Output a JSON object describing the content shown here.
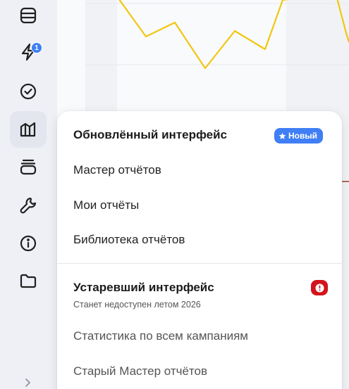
{
  "sidebar": {
    "icons": [
      {
        "name": "database-icon"
      },
      {
        "name": "lightning-icon",
        "badge": "1"
      },
      {
        "name": "check-circle-icon"
      },
      {
        "name": "reports-icon",
        "active": true
      },
      {
        "name": "stack-icon"
      },
      {
        "name": "wrench-icon"
      },
      {
        "name": "info-icon"
      },
      {
        "name": "folder-icon"
      }
    ],
    "expand_icon": "chevron-right-icon"
  },
  "menu": {
    "new_section": {
      "title": "Обновлённый интерфейс",
      "badge_label": "Новый",
      "badge_icon": "star-icon",
      "badge_color": "#3f7ef5",
      "items": [
        "Мастер отчётов",
        "Мои отчёты",
        "Библиотека отчётов"
      ]
    },
    "legacy_section": {
      "title": "Устаревший интерфейс",
      "subtitle": "Станет недоступен летом 2026",
      "warning_icon": "exclamation-icon",
      "warning_color": "#d3141c",
      "items": [
        "Статистика по всем кампаниям",
        "Старый Мастер отчётов"
      ]
    }
  },
  "colors": {
    "accent": "#3f7ef5",
    "chart_line": "#f2c611"
  }
}
